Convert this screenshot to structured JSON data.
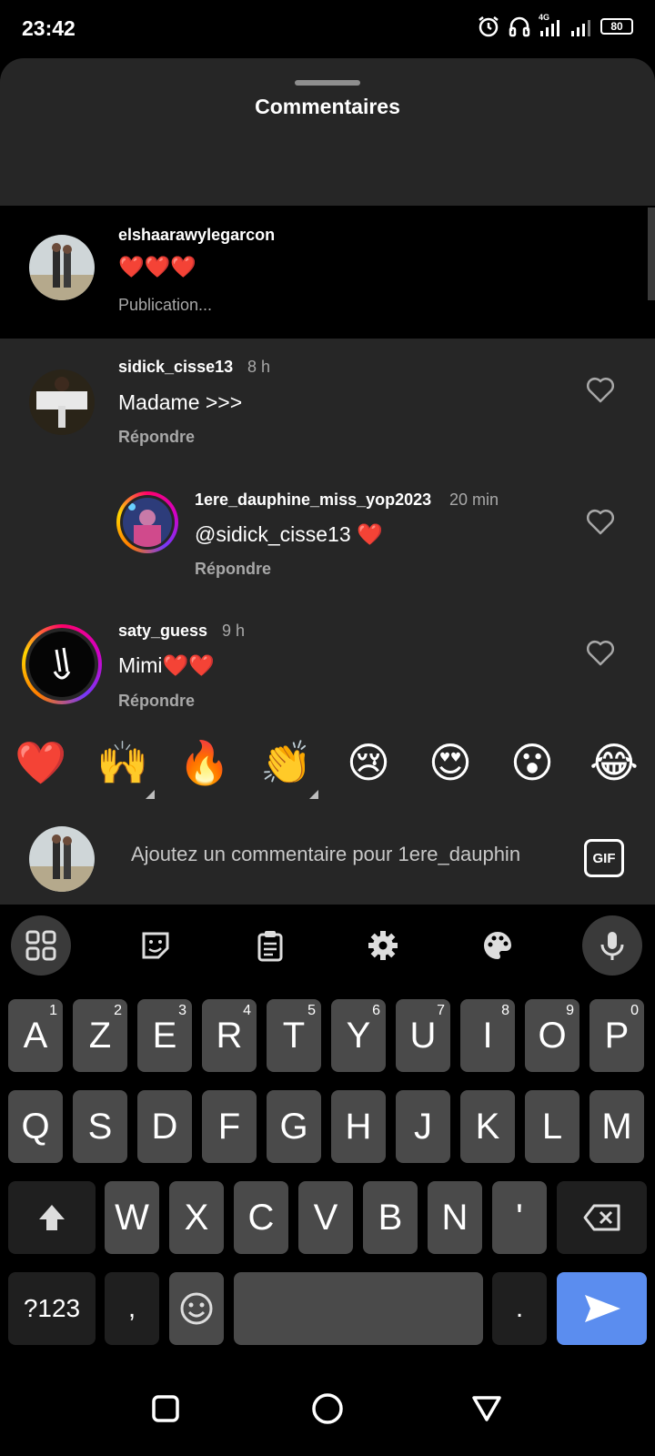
{
  "status": {
    "time": "23:42",
    "network": "4G",
    "battery": "80"
  },
  "sheet": {
    "title": "Commentaires"
  },
  "caption": {
    "username": "elshaarawylegarcon",
    "text": "❤️❤️❤️",
    "meta": "Publication..."
  },
  "comments": [
    {
      "username": "sidick_cisse13",
      "time": "8 h",
      "text": "Madame >>>",
      "reply": "Répondre"
    },
    {
      "username": "1ere_dauphine_miss_yop2023",
      "time": "20 min",
      "text": "@sidick_cisse13 ❤️",
      "reply": "Répondre"
    },
    {
      "username": "saty_guess",
      "time": "9 h",
      "text": "Mimi❤️❤️",
      "reply": "Répondre"
    }
  ],
  "quick_emojis": [
    "❤️",
    "🙌",
    "🔥",
    "👏",
    "😢",
    "😍",
    "😮",
    "😂"
  ],
  "composer": {
    "placeholder": "Ajoutez un commentaire pour 1ere_dauphin",
    "gif_label": "GIF"
  },
  "keyboard": {
    "row1": [
      [
        "A",
        "1"
      ],
      [
        "Z",
        "2"
      ],
      [
        "E",
        "3"
      ],
      [
        "R",
        "4"
      ],
      [
        "T",
        "5"
      ],
      [
        "Y",
        "6"
      ],
      [
        "U",
        "7"
      ],
      [
        "I",
        "8"
      ],
      [
        "O",
        "9"
      ],
      [
        "P",
        "0"
      ]
    ],
    "row2": [
      "Q",
      "S",
      "D",
      "F",
      "G",
      "H",
      "J",
      "K",
      "L",
      "M"
    ],
    "row3": [
      "W",
      "X",
      "C",
      "V",
      "B",
      "N",
      "'"
    ],
    "symbols_label": "?123",
    "comma": ",",
    "period": "."
  },
  "colors": {
    "sheet_bg": "#262626",
    "key_bg": "#4a4a4a",
    "send_blue": "#5b8def",
    "heart_red": "#e0245e"
  }
}
